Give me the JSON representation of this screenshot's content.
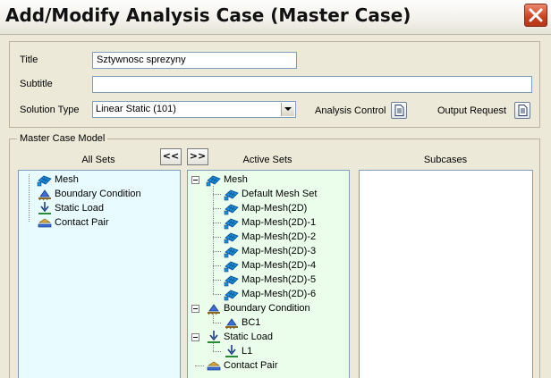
{
  "window": {
    "title": "Add/Modify Analysis Case (Master Case)"
  },
  "form": {
    "title_label": "Title",
    "title_value": "Sztywnosc sprezyny",
    "subtitle_label": "Subtitle",
    "subtitle_value": "",
    "solution_type_label": "Solution Type",
    "solution_type_value": "Linear Static (101)",
    "analysis_control_label": "Analysis Control",
    "output_request_label": "Output Request"
  },
  "master_case": {
    "group_label": "Master Case Model",
    "move_left_label": "<<",
    "move_right_label": ">>",
    "all_sets": {
      "header": "All Sets",
      "items": [
        {
          "label": "Mesh",
          "icon": "mesh-icon"
        },
        {
          "label": "Boundary Condition",
          "icon": "boundary-condition-icon"
        },
        {
          "label": "Static Load",
          "icon": "static-load-icon"
        },
        {
          "label": "Contact Pair",
          "icon": "contact-pair-icon"
        }
      ]
    },
    "active_sets": {
      "header": "Active Sets",
      "groups": [
        {
          "label": "Mesh",
          "icon": "mesh-icon",
          "children": [
            "Default Mesh Set",
            "Map-Mesh(2D)",
            "Map-Mesh(2D)-1",
            "Map-Mesh(2D)-2",
            "Map-Mesh(2D)-3",
            "Map-Mesh(2D)-4",
            "Map-Mesh(2D)-5",
            "Map-Mesh(2D)-6"
          ]
        },
        {
          "label": "Boundary Condition",
          "icon": "boundary-condition-icon",
          "children": [
            "BC1"
          ]
        },
        {
          "label": "Static Load",
          "icon": "static-load-icon",
          "children": [
            "L1"
          ]
        },
        {
          "label": "Contact Pair",
          "icon": "contact-pair-icon",
          "children": []
        }
      ]
    },
    "subcases": {
      "header": "Subcases",
      "items": []
    }
  },
  "colors": {
    "all_sets_bg": "#e8fbff",
    "active_sets_bg": "#ebfdeb",
    "subcases_bg": "#ffffff",
    "mesh_icon": "#1a8fe0",
    "close_button": "#c7411f"
  }
}
